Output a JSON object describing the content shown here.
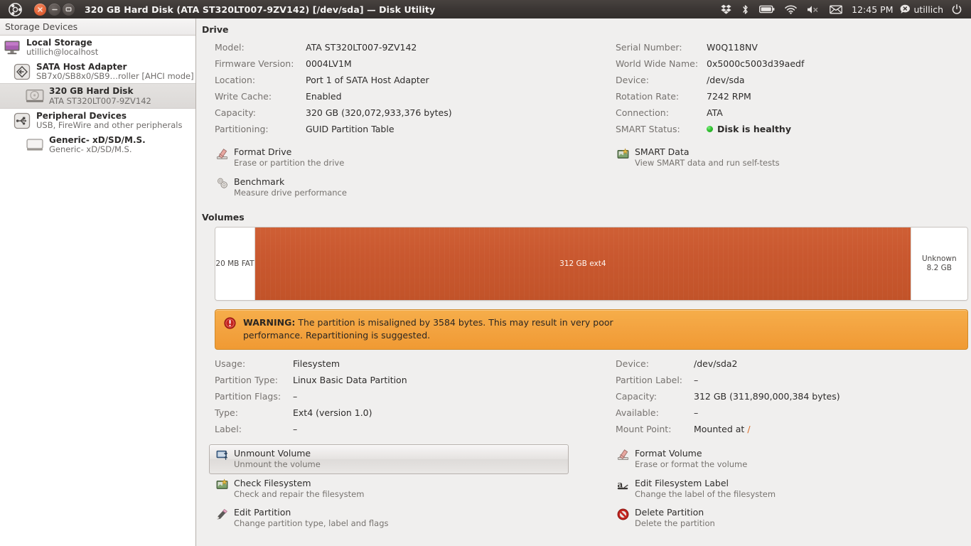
{
  "titlebar": {
    "title": "320 GB Hard Disk (ATA ST320LT007-9ZV142) [/dev/sda] — Disk Utility",
    "close_label": "Close",
    "minimize_label": "Minimize",
    "maximize_label": "Maximize",
    "clock": "12:45 PM",
    "user": "utillich",
    "tray_icons": [
      "dropbox-icon",
      "bluetooth-icon",
      "battery-icon",
      "wifi-icon",
      "volume-muted-icon",
      "mail-icon",
      "power-icon"
    ]
  },
  "sidebar": {
    "header": "Storage Devices",
    "items": [
      {
        "title": "Local Storage",
        "sub": "utillich@localhost",
        "icon": "monitor-icon",
        "indent": 0,
        "selected": false
      },
      {
        "title": "SATA Host Adapter",
        "sub": "SB7x0/SB8x0/SB9…roller [AHCI mode]",
        "icon": "controller-icon",
        "indent": 1,
        "selected": false
      },
      {
        "title": "320 GB Hard Disk",
        "sub": "ATA ST320LT007-9ZV142",
        "icon": "harddisk-icon",
        "indent": 2,
        "selected": true
      },
      {
        "title": "Peripheral Devices",
        "sub": "USB, FireWire and other peripherals",
        "icon": "usb-icon",
        "indent": 1,
        "selected": false
      },
      {
        "title": "Generic- xD/SD/M.S.",
        "sub": "Generic- xD/SD/M.S.",
        "icon": "drive-icon",
        "indent": 2,
        "selected": false
      }
    ]
  },
  "drive": {
    "section_title": "Drive",
    "left_fields": [
      {
        "key": "Model:",
        "value": "ATA ST320LT007-9ZV142"
      },
      {
        "key": "Firmware Version:",
        "value": "0004LV1M"
      },
      {
        "key": "Location:",
        "value": "Port 1 of SATA Host Adapter"
      },
      {
        "key": "Write Cache:",
        "value": "Enabled"
      },
      {
        "key": "Capacity:",
        "value": "320 GB (320,072,933,376 bytes)"
      },
      {
        "key": "Partitioning:",
        "value": "GUID Partition Table"
      }
    ],
    "right_fields": [
      {
        "key": "Serial Number:",
        "value": "W0Q118NV"
      },
      {
        "key": "World Wide Name:",
        "value": "0x5000c5003d39aedf"
      },
      {
        "key": "Device:",
        "value": "/dev/sda"
      },
      {
        "key": "Rotation Rate:",
        "value": "7242 RPM"
      },
      {
        "key": "Connection:",
        "value": "ATA"
      },
      {
        "key": "SMART Status:",
        "value": "Disk is healthy",
        "status": "ok"
      }
    ],
    "left_actions": [
      {
        "title": "Format Drive",
        "sub": "Erase or partition the drive",
        "icon": "eraser-icon"
      },
      {
        "title": "Benchmark",
        "sub": "Measure drive performance",
        "icon": "gears-icon"
      }
    ],
    "right_actions": [
      {
        "title": "SMART Data",
        "sub": "View SMART data and run self-tests",
        "icon": "chart-icon"
      }
    ]
  },
  "volumes": {
    "section_title": "Volumes",
    "segments": [
      {
        "label": "20 MB FAT",
        "label2": "",
        "kind": "unallocated",
        "width_pct": 5.2
      },
      {
        "label": "312 GB ext4",
        "label2": "",
        "kind": "used",
        "width_pct": 87.3,
        "selected": true
      },
      {
        "label": "Unknown",
        "label2": "8.2 GB",
        "kind": "unallocated",
        "width_pct": 7.5
      }
    ]
  },
  "warning": {
    "prefix": "WARNING:",
    "text": " The partition is misaligned by 3584 bytes. This may result in very poor performance. Repartitioning is suggested.",
    "icon": "error-icon"
  },
  "volume_details": {
    "left_fields": [
      {
        "key": "Usage:",
        "value": "Filesystem"
      },
      {
        "key": "Partition Type:",
        "value": "Linux Basic Data Partition"
      },
      {
        "key": "Partition Flags:",
        "value": "–"
      },
      {
        "key": "Type:",
        "value": "Ext4 (version 1.0)"
      },
      {
        "key": "Label:",
        "value": "–"
      }
    ],
    "right_fields": [
      {
        "key": "Device:",
        "value": "/dev/sda2"
      },
      {
        "key": "Partition Label:",
        "value": "–"
      },
      {
        "key": "Capacity:",
        "value": "312 GB (311,890,000,384 bytes)"
      },
      {
        "key": "Available:",
        "value": "–"
      },
      {
        "key": "Mount Point:",
        "value": "Mounted at ",
        "link": "/"
      }
    ],
    "left_actions": [
      {
        "title": "Unmount Volume",
        "sub": "Unmount the volume",
        "icon": "unmount-icon",
        "focused": true
      },
      {
        "title": "Check Filesystem",
        "sub": "Check and repair the filesystem",
        "icon": "chart-icon",
        "focused": false
      },
      {
        "title": "Edit Partition",
        "sub": "Change partition type, label and flags",
        "icon": "pencil-icon",
        "focused": false
      }
    ],
    "right_actions": [
      {
        "title": "Format Volume",
        "sub": "Erase or format the volume",
        "icon": "eraser-icon"
      },
      {
        "title": "Edit Filesystem Label",
        "sub": "Change the label of the filesystem",
        "icon": "label-icon"
      },
      {
        "title": "Delete Partition",
        "sub": "Delete the partition",
        "icon": "delete-icon"
      }
    ]
  },
  "colors": {
    "titlebar": "#3b3634",
    "accent_orange": "#c9582f",
    "warning_bg": "#f3a340",
    "link": "#dd6a23",
    "smart_green": "#33c133"
  }
}
